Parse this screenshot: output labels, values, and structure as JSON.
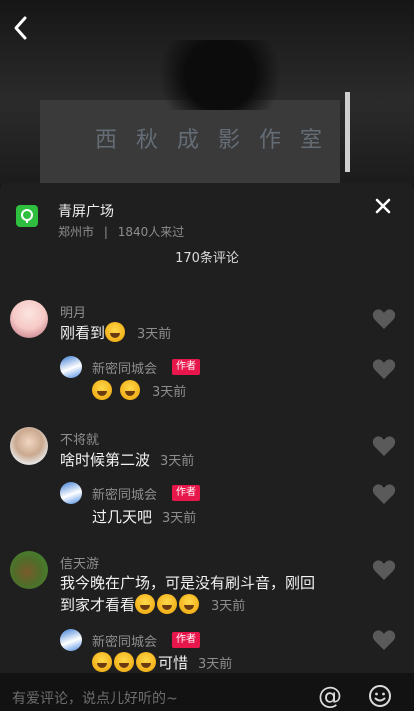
{
  "header": {
    "back_icon": "chevron-left-icon"
  },
  "location": {
    "title": "青屏广场",
    "city": "郑州市",
    "separator": "|",
    "visitors": "1840人来过",
    "icon": "location-pin-icon",
    "icon_color": "#2fbf3f"
  },
  "video_text": "西 秋 成 影 作 室",
  "comments_count": "170条评论",
  "comments": [
    {
      "name": "明月",
      "text": "刚看到",
      "emoji_count": 1,
      "time": "3天前",
      "reply": {
        "name": "新密同城会",
        "badge": "作者",
        "text": "",
        "emoji_count": 2,
        "time": "3天前"
      }
    },
    {
      "name": "不将就",
      "text": "啥时候第二波",
      "emoji_count": 0,
      "time": "3天前",
      "reply": {
        "name": "新密同城会",
        "badge": "作者",
        "text": "过几天吧",
        "emoji_count": 0,
        "time": "3天前"
      }
    },
    {
      "name": "信天游",
      "text_line1": "我今晚在广场，可是没有刷斗音，刚回",
      "text_line2": "到家才看看",
      "emoji_count": 3,
      "time": "3天前",
      "reply": {
        "name": "新密同城会",
        "badge": "作者",
        "text": "可惜",
        "emoji_count": 3,
        "time": "3天前"
      }
    }
  ],
  "input": {
    "placeholder": "有爱评论，说点儿好听的~",
    "at_label": "@"
  },
  "colors": {
    "badge": "#e8174b",
    "panel": "#1f1f1f"
  }
}
